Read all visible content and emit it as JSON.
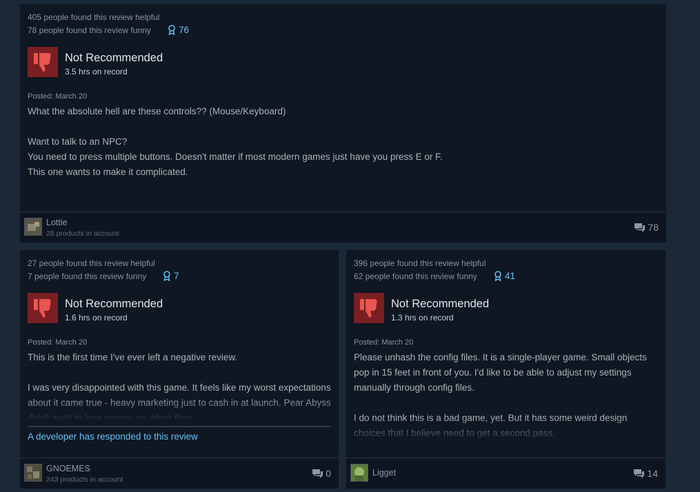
{
  "reviews": [
    {
      "helpful": "405 people found this review helpful",
      "funny": "78 people found this review funny",
      "awards": "76",
      "verdict": "Not Recommended",
      "hours": "3.5 hrs on record",
      "posted": "Posted: March 20",
      "text": [
        "What the absolute hell are these controls?? (Mouse/Keyboard)",
        "",
        "Want to talk to an NPC?",
        "You need to press multiple buttons. Doesn't matter if most modern games just have you press E or F.",
        "This one wants to make it complicated."
      ],
      "developer_response": "",
      "user": {
        "name": "Lottie",
        "products": "28 products in account"
      },
      "comments": "78",
      "colors": {
        "avatar": "#6f6a5e"
      }
    },
    {
      "helpful": "27 people found this review helpful",
      "funny": "7 people found this review funny",
      "awards": "7",
      "verdict": "Not Recommended",
      "hours": "1.6 hrs on record",
      "posted": "Posted: March 20",
      "text": [
        "This is the first time I've ever left a negative review.",
        "",
        "I was very disappointed with this game. It feels like my worst expectations about it came true - heavy marketing just to cash in at launch. Pear Abyss didn't want to lose money, so when they"
      ],
      "developer_response": "A developer has responded to this review",
      "user": {
        "name": "GNOEMES",
        "products": "243 products in account"
      },
      "comments": "0",
      "colors": {
        "avatar": "#5c5a48"
      }
    },
    {
      "helpful": "396 people found this review helpful",
      "funny": "62 people found this review funny",
      "awards": "41",
      "verdict": "Not Recommended",
      "hours": "1.3 hrs on record",
      "posted": "Posted: March 20",
      "text": [
        "Please unhash the config files. It is a single-player game. Small objects pop in 15 feet in front of you. I'd like to be able to adjust my settings manually through config files.",
        "",
        "I do not think this is a bad game, yet. But it has some weird design choices that I believe need to get a second pass."
      ],
      "developer_response": "",
      "user": {
        "name": "Ligget",
        "products": ""
      },
      "comments": "14",
      "colors": {
        "avatar": "#6b8a4a"
      }
    }
  ],
  "colors": {
    "page_bg": "#1b2838",
    "card_bg": "#0f1722",
    "thumb_bg": "#7a1f22",
    "thumb_icon": "#e9564f",
    "award_blue": "#66c0f4"
  },
  "icons": {
    "thumbs_down": "thumbs-down-icon",
    "award": "award-ribbon-icon",
    "comment": "comment-bubble-icon"
  }
}
